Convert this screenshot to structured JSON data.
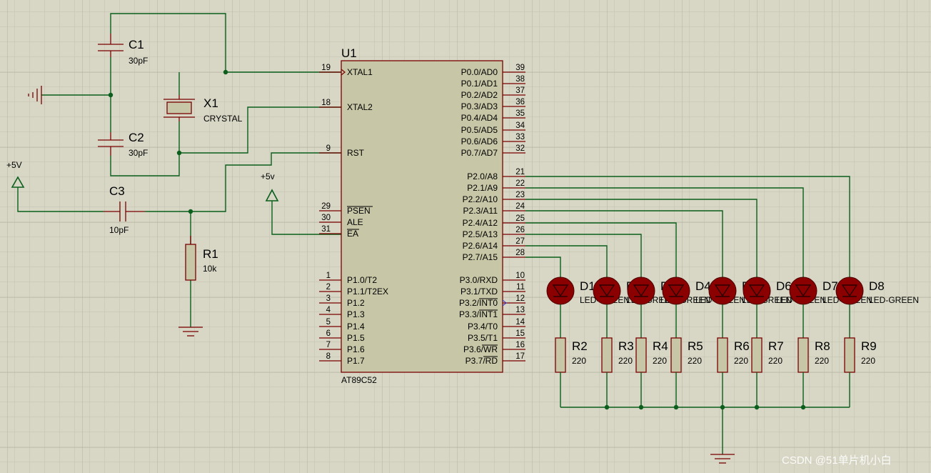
{
  "chip": {
    "ref": "U1",
    "part": "AT89C52",
    "left_pins": [
      {
        "num": "19",
        "name": "XTAL1"
      },
      {
        "num": "18",
        "name": "XTAL2"
      },
      {
        "num": "9",
        "name": "RST"
      },
      {
        "num": "29",
        "name": "PSEN"
      },
      {
        "num": "30",
        "name": "ALE"
      },
      {
        "num": "31",
        "name": "EA"
      },
      {
        "num": "1",
        "name": "P1.0/T2"
      },
      {
        "num": "2",
        "name": "P1.1/T2EX"
      },
      {
        "num": "3",
        "name": "P1.2"
      },
      {
        "num": "4",
        "name": "P1.3"
      },
      {
        "num": "5",
        "name": "P1.4"
      },
      {
        "num": "6",
        "name": "P1.5"
      },
      {
        "num": "7",
        "name": "P1.6"
      },
      {
        "num": "8",
        "name": "P1.7"
      }
    ],
    "right_pins": [
      {
        "num": "39",
        "name": "P0.0/AD0"
      },
      {
        "num": "38",
        "name": "P0.1/AD1"
      },
      {
        "num": "37",
        "name": "P0.2/AD2"
      },
      {
        "num": "36",
        "name": "P0.3/AD3"
      },
      {
        "num": "35",
        "name": "P0.4/AD4"
      },
      {
        "num": "34",
        "name": "P0.5/AD5"
      },
      {
        "num": "33",
        "name": "P0.6/AD6"
      },
      {
        "num": "32",
        "name": "P0.7/AD7"
      },
      {
        "num": "21",
        "name": "P2.0/A8"
      },
      {
        "num": "22",
        "name": "P2.1/A9"
      },
      {
        "num": "23",
        "name": "P2.2/A10"
      },
      {
        "num": "24",
        "name": "P2.3/A11"
      },
      {
        "num": "25",
        "name": "P2.4/A12"
      },
      {
        "num": "26",
        "name": "P2.5/A13"
      },
      {
        "num": "27",
        "name": "P2.6/A14"
      },
      {
        "num": "28",
        "name": "P2.7/A15"
      },
      {
        "num": "10",
        "name": "P3.0/RXD"
      },
      {
        "num": "11",
        "name": "P3.1/TXD"
      },
      {
        "num": "12",
        "name": "P3.2/INT0"
      },
      {
        "num": "13",
        "name": "P3.3/INT1"
      },
      {
        "num": "14",
        "name": "P3.4/T0"
      },
      {
        "num": "15",
        "name": "P3.5/T1"
      },
      {
        "num": "16",
        "name": "P3.6/WR"
      },
      {
        "num": "17",
        "name": "P3.7/RD"
      }
    ]
  },
  "components": {
    "c1": {
      "ref": "C1",
      "value": "30pF"
    },
    "c2": {
      "ref": "C2",
      "value": "30pF"
    },
    "c3": {
      "ref": "C3",
      "value": "10pF"
    },
    "x1": {
      "ref": "X1",
      "value": "CRYSTAL"
    },
    "r1": {
      "ref": "R1",
      "value": "10k"
    }
  },
  "power": {
    "vcc_left": "+5V",
    "vcc_ea": "+5v"
  },
  "leds": [
    {
      "ref": "D1",
      "value": "LED-GREEN"
    },
    {
      "ref": "D2",
      "value": "LED-GREEN"
    },
    {
      "ref": "D3",
      "value": "LED-GREEN"
    },
    {
      "ref": "D4",
      "value": "LED-GREEN"
    },
    {
      "ref": "D5",
      "value": "LED-GREEN"
    },
    {
      "ref": "D6",
      "value": "LED-GREEN"
    },
    {
      "ref": "D7",
      "value": "LED-GREEN"
    },
    {
      "ref": "D8",
      "value": "LED-GREEN"
    }
  ],
  "resistors": [
    {
      "ref": "R2",
      "value": "220"
    },
    {
      "ref": "R3",
      "value": "220"
    },
    {
      "ref": "R4",
      "value": "220"
    },
    {
      "ref": "R5",
      "value": "220"
    },
    {
      "ref": "R6",
      "value": "220"
    },
    {
      "ref": "R7",
      "value": "220"
    },
    {
      "ref": "R8",
      "value": "220"
    },
    {
      "ref": "R9",
      "value": "220"
    }
  ],
  "watermark": "CSDN @51单片机小白"
}
